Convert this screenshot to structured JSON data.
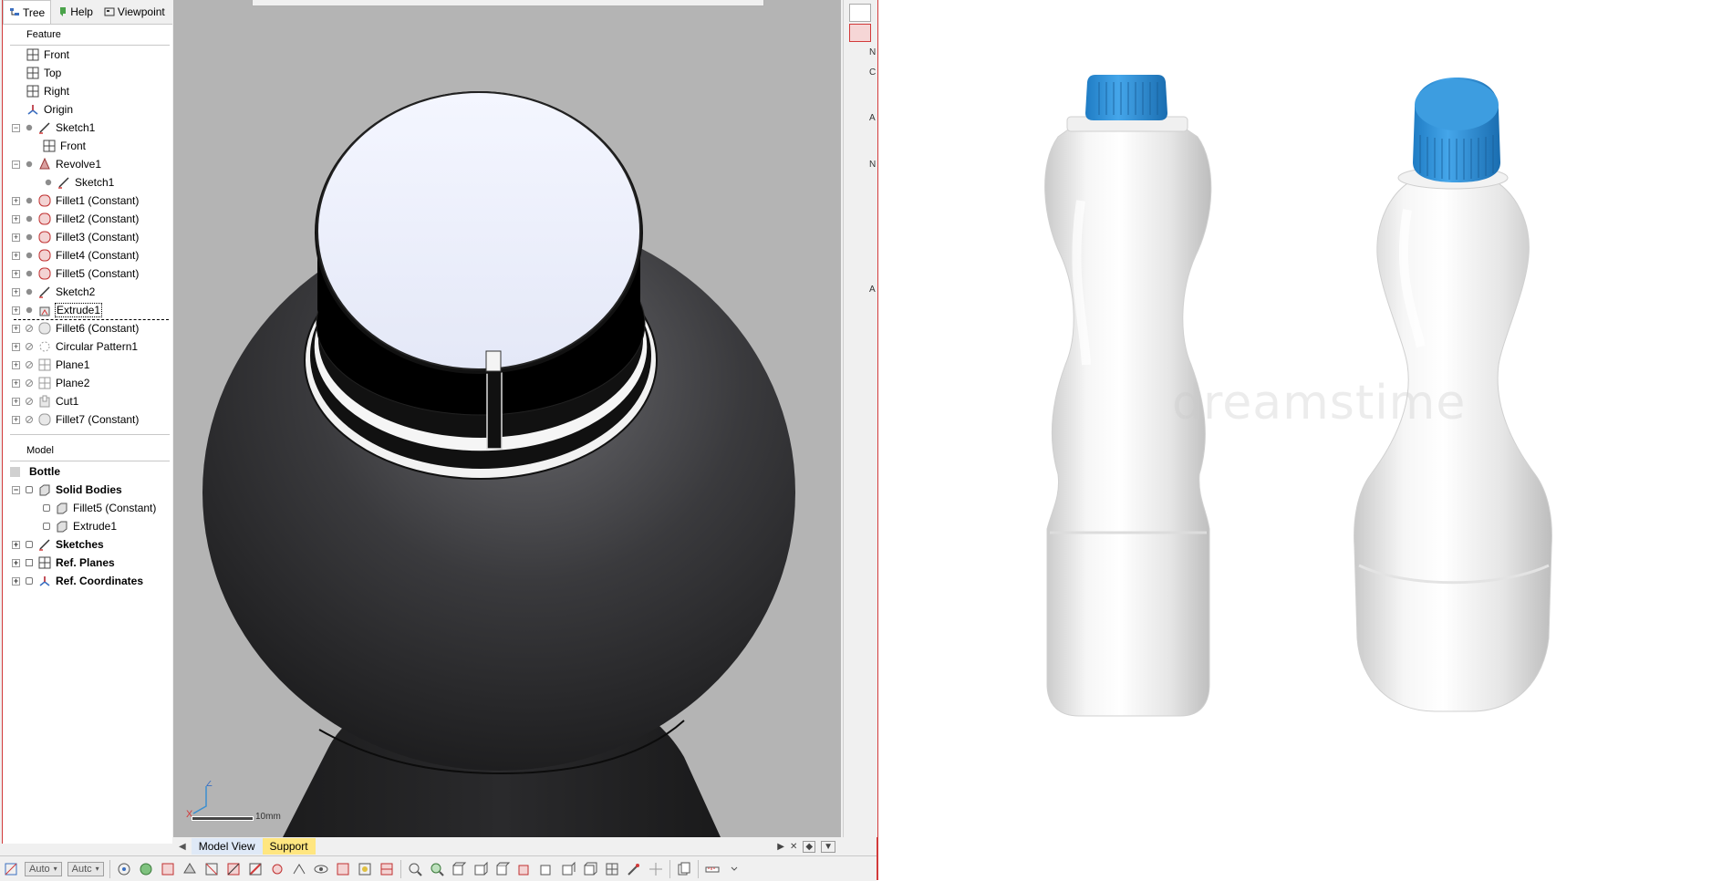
{
  "tabs": [
    {
      "label": "Tree",
      "icon": "tree-icon",
      "active": true
    },
    {
      "label": "Help",
      "icon": "help-icon",
      "active": false
    },
    {
      "label": "Viewpoint",
      "icon": "viewpoint-icon",
      "active": false
    }
  ],
  "feature_section": {
    "title": "Feature",
    "items": [
      {
        "label": "Front",
        "icon": "plane-icon"
      },
      {
        "label": "Top",
        "icon": "plane-icon"
      },
      {
        "label": "Right",
        "icon": "plane-icon"
      },
      {
        "label": "Origin",
        "icon": "origin-icon"
      },
      {
        "label": "Sketch1",
        "icon": "sketch-icon"
      },
      {
        "label": "Front",
        "icon": "plane-icon"
      },
      {
        "label": "Revolve1",
        "icon": "revolve-icon"
      },
      {
        "label": "Sketch1",
        "icon": "sketch-icon"
      },
      {
        "label": "Fillet1 (Constant)",
        "icon": "fillet-icon"
      },
      {
        "label": "Fillet2 (Constant)",
        "icon": "fillet-icon"
      },
      {
        "label": "Fillet3 (Constant)",
        "icon": "fillet-icon"
      },
      {
        "label": "Fillet4 (Constant)",
        "icon": "fillet-icon"
      },
      {
        "label": "Fillet5 (Constant)",
        "icon": "fillet-icon"
      },
      {
        "label": "Sketch2",
        "icon": "sketch-icon"
      },
      {
        "label": "Extrude1",
        "icon": "extrude-icon"
      },
      {
        "label": "Fillet6 (Constant)",
        "icon": "fillet-icon"
      },
      {
        "label": "Circular Pattern1",
        "icon": "circular-pattern-icon"
      },
      {
        "label": "Plane1",
        "icon": "plane-icon"
      },
      {
        "label": "Plane2",
        "icon": "plane-icon"
      },
      {
        "label": "Cut1",
        "icon": "cut-icon"
      },
      {
        "label": "Fillet7 (Constant)",
        "icon": "fillet-icon"
      }
    ]
  },
  "model_section": {
    "title": "Model",
    "root": "Bottle",
    "items": [
      {
        "label": "Solid Bodies",
        "icon": "solid-body-icon"
      },
      {
        "label": "Fillet5 (Constant)",
        "icon": "solid-body-icon"
      },
      {
        "label": "Extrude1",
        "icon": "solid-body-icon"
      },
      {
        "label": "Sketches",
        "icon": "sketch-icon"
      },
      {
        "label": "Ref. Planes",
        "icon": "plane-icon"
      },
      {
        "label": "Ref. Coordinates",
        "icon": "origin-icon"
      }
    ]
  },
  "viewport": {
    "scale_label": "10mm",
    "axes": {
      "z": "Z",
      "x": "X"
    }
  },
  "bottom_tabs": [
    {
      "label": "Model View"
    },
    {
      "label": "Support"
    }
  ],
  "toolbar": {
    "combo1": "Auto",
    "combo2": "Autc"
  },
  "photo": {
    "watermark": "dreamstime"
  },
  "colors": {
    "accent_red": "#d23a3a",
    "cap_blue": "#2f8fd8",
    "support_tab": "#ffe680"
  }
}
